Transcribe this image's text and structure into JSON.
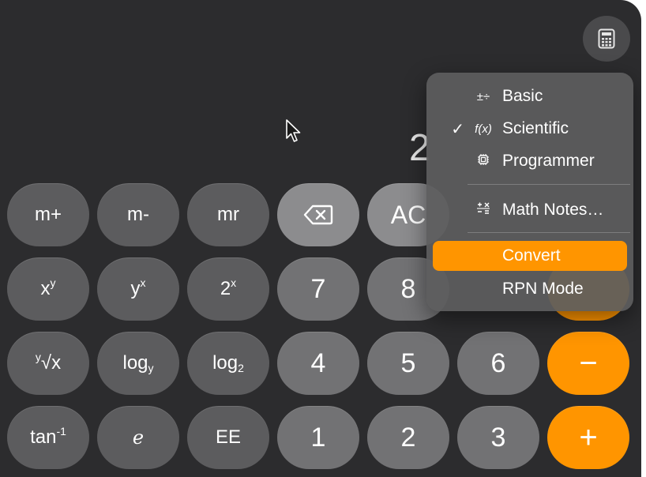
{
  "display": {
    "value": "2"
  },
  "mode_button": {
    "icon": "calculator-icon"
  },
  "keys": {
    "row1": [
      "m+",
      "m-",
      "mr",
      "",
      "AC"
    ],
    "x_pow_y": {
      "base": "x",
      "exp": "y"
    },
    "y_pow_x": {
      "base": "y",
      "exp": "x"
    },
    "two_pow_x": {
      "base": "2",
      "exp": "x"
    },
    "seven": "7",
    "eight": "8",
    "yroot": {
      "index": "y",
      "rad": "√x"
    },
    "logy": {
      "base": "log",
      "sub": "y"
    },
    "log2": {
      "base": "log",
      "sub": "2"
    },
    "four": "4",
    "five": "5",
    "six": "6",
    "minus": "−",
    "tan_inv": {
      "base": "tan",
      "exp": "-1"
    },
    "e": "e",
    "ee": "EE",
    "one": "1",
    "two": "2",
    "three": "3",
    "plus": "+"
  },
  "menu": {
    "basic": "Basic",
    "basic_icon": "±÷",
    "scientific": "Scientific",
    "scientific_icon": "f(x)",
    "check": "✓",
    "programmer": "Programmer",
    "math_notes": "Math Notes…",
    "convert": "Convert",
    "rpn": "RPN Mode"
  },
  "colors": {
    "accent": "#ff9500",
    "window": "#2c2c2e"
  }
}
